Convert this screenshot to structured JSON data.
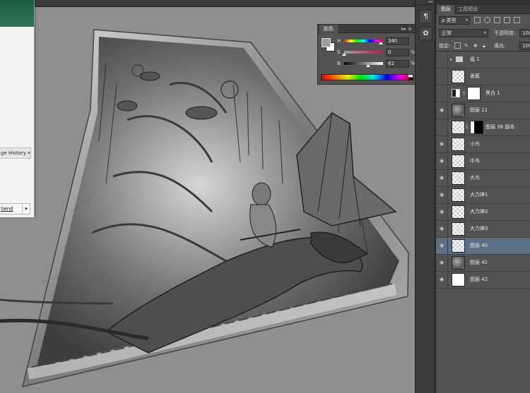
{
  "chat_window": {
    "history_label": "ge History",
    "send_label": "Send"
  },
  "color_panel": {
    "tab_label": "颜色",
    "menu_glyph": "▸▸ ≡",
    "fg_color": "#9e9e9e",
    "bg_color": "#ffffff",
    "sliders": [
      {
        "label": "H",
        "value": "340",
        "unit": "",
        "fraction": 0.94
      },
      {
        "label": "S",
        "value": "0",
        "unit": "%",
        "fraction": 0.0
      },
      {
        "label": "B",
        "value": "62",
        "unit": "%",
        "fraction": 0.62
      }
    ]
  },
  "tool_strip": {
    "grip": "◂◂",
    "tools": [
      {
        "name": "character-panel-icon",
        "glyph": "¶"
      },
      {
        "name": "brush-presets-icon",
        "glyph": "✿"
      }
    ]
  },
  "layers_panel": {
    "tabs": [
      "图层",
      "工具预设"
    ],
    "filter_type": "ρ 类型",
    "blend_mode": "正常",
    "opacity_label": "不透明度:",
    "opacity_value": "100",
    "lock_label": "锁定:",
    "fill_label": "填充:",
    "fill_value": "100",
    "layers": [
      {
        "name": "组 1",
        "kind": "group",
        "visible": false
      },
      {
        "name": "香蕉",
        "kind": "transparent",
        "visible": false
      },
      {
        "name": "黑白 1",
        "kind": "adjustment",
        "visible": false
      },
      {
        "name": "图层 11",
        "kind": "art",
        "visible": true
      },
      {
        "name": "图层 38 副本",
        "kind": "masked",
        "visible": false
      },
      {
        "name": "小鸟",
        "kind": "transparent",
        "visible": true
      },
      {
        "name": "中鸟",
        "kind": "transparent",
        "visible": true
      },
      {
        "name": "大鸟",
        "kind": "transparent",
        "visible": true
      },
      {
        "name": "大力神1",
        "kind": "transparent",
        "visible": true
      },
      {
        "name": "大力神2",
        "kind": "transparent",
        "visible": true
      },
      {
        "name": "大力神3",
        "kind": "transparent",
        "visible": true
      },
      {
        "name": "图层 40",
        "kind": "transparent",
        "visible": true,
        "selected": true
      },
      {
        "name": "图层 41",
        "kind": "art",
        "visible": true
      },
      {
        "name": "图层 42",
        "kind": "white",
        "visible": true
      }
    ]
  },
  "colors": {
    "canvas_gray": "#8f8f8f",
    "panel": "#535353",
    "selected_row": "#5c6f87"
  }
}
